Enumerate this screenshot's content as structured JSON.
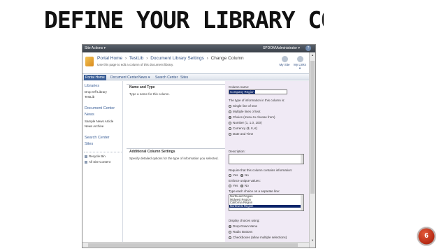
{
  "slide": {
    "title": "DEFINE YOUR LIBRARY COLUMN",
    "page_number": "6"
  },
  "topbar": {
    "site_actions": "Site Actions ▾",
    "user": "SPDOM\\Administrator ▾",
    "help_icon": "help-icon"
  },
  "header": {
    "breadcrumb": [
      "Portal Home",
      "TestLib",
      "Document Library Settings",
      "Change Column"
    ],
    "separator": "›",
    "subtitle": "Use this page to edit a column of this document library.",
    "my_site": "My Site",
    "my_links": "My Links ▾"
  },
  "nav": {
    "tabs": [
      "Portal Home",
      "Document Center",
      "News ▾",
      "Search Center",
      "Sites"
    ]
  },
  "left_nav": {
    "libraries_heading": "Libraries",
    "libraries": [
      "Drop Off Library",
      "TestLib"
    ],
    "document_center_heading": "Document Center",
    "news_heading": "News",
    "news_items": [
      "Sample News Article",
      "News Archive"
    ],
    "search_center_heading": "Search Center",
    "sites_heading": "Sites",
    "recycle_bin": "Recycle Bin",
    "all_site_content": "All Site Content"
  },
  "main": {
    "name_type_heading": "Name and Type",
    "name_type_desc": "Type a name for this column.",
    "additional_heading": "Additional Column Settings",
    "additional_desc": "Specify detailed options for the type of information you selected."
  },
  "form": {
    "column_name_label": "Column name:",
    "column_name_value": "Company Region",
    "type_label": "The type of information in this column is:",
    "types": [
      {
        "label": "Single line of text",
        "selected": false
      },
      {
        "label": "Multiple lines of text",
        "selected": false
      },
      {
        "label": "Choice (menu to choose from)",
        "selected": true
      },
      {
        "label": "Number (1, 1.0, 100)",
        "selected": false
      },
      {
        "label": "Currency ($, ¥, €)",
        "selected": false
      },
      {
        "label": "Date and Time",
        "selected": false
      }
    ],
    "description_label": "Description:",
    "require_label": "Require that this column contains information:",
    "yes": "Yes",
    "no": "No",
    "enforce_label": "Enforce unique values:",
    "choices_label": "Type each choice on a separate line:",
    "choices": [
      "Northeast Region",
      "Midwest Region",
      "California Region",
      "Northwest Region"
    ],
    "display_label": "Display choices using:",
    "display_options": [
      {
        "label": "Drop-Down Menu",
        "selected": true
      },
      {
        "label": "Radio Buttons",
        "selected": false
      },
      {
        "label": "Checkboxes (allow multiple selections)",
        "selected": false
      }
    ]
  }
}
